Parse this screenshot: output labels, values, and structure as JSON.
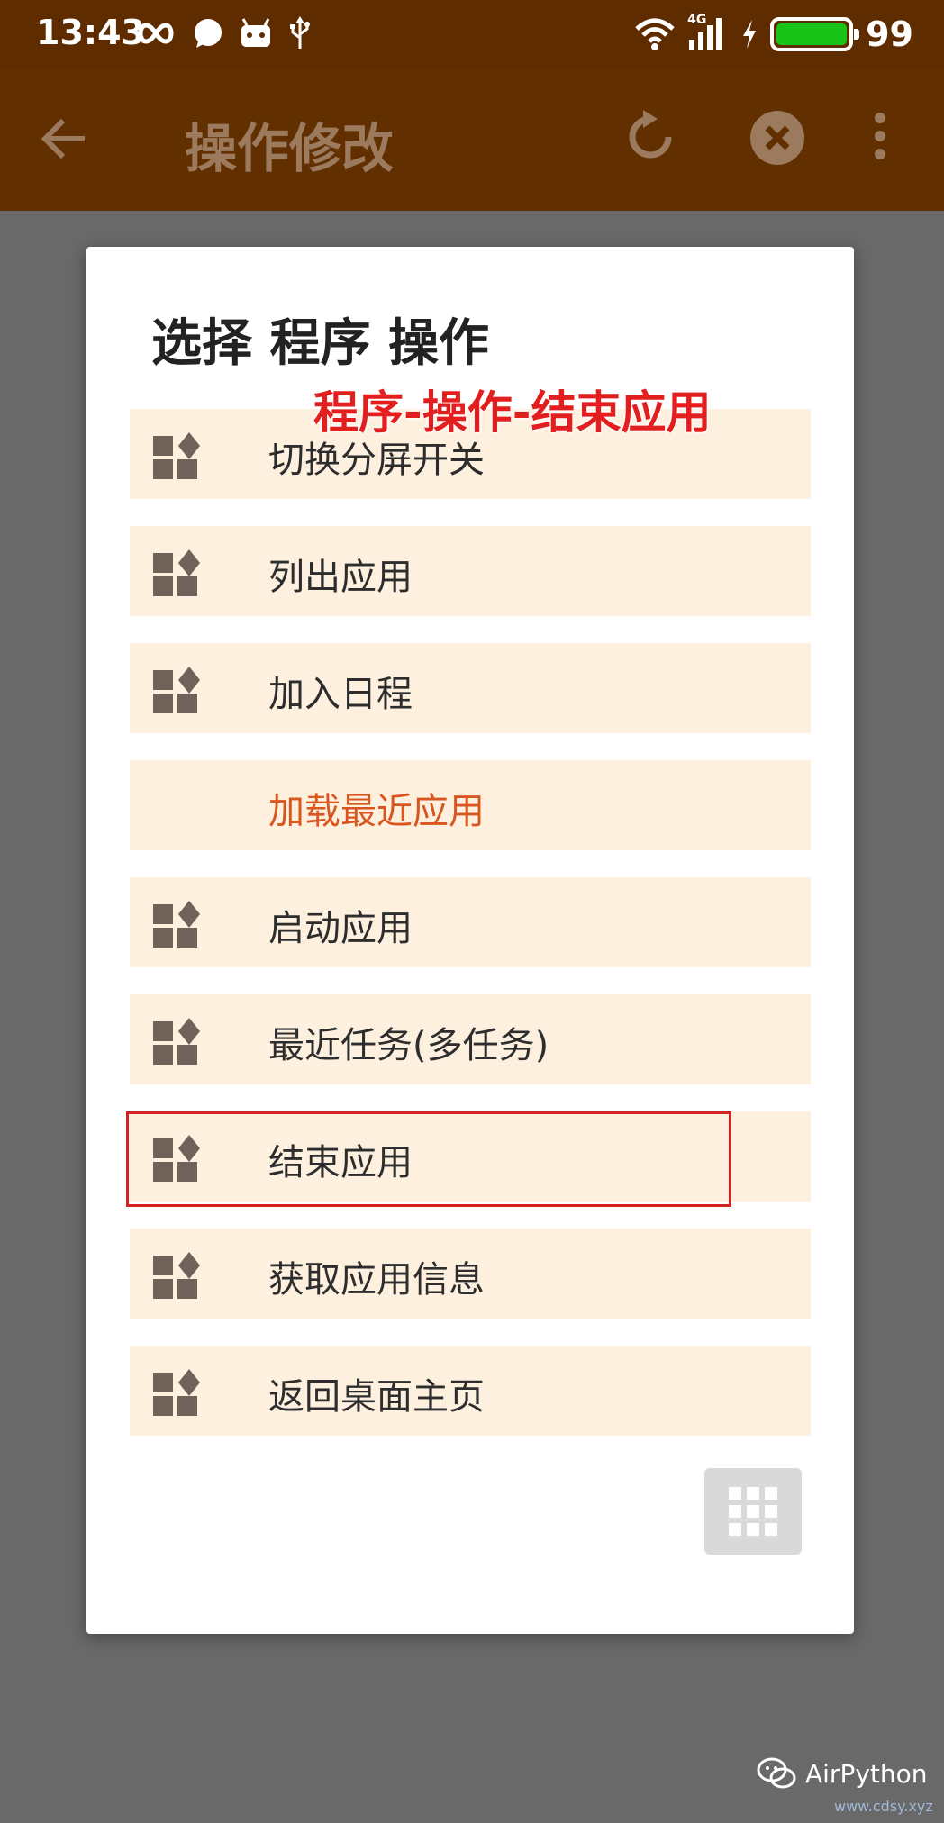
{
  "status_bar": {
    "time": "13:43",
    "network": "4G",
    "battery_level": "99",
    "colors": {
      "background": "#5f2c00",
      "battery": "#18c418"
    }
  },
  "app_bar": {
    "title": "操作修改",
    "icons": [
      "arrow-back-icon",
      "refresh-icon",
      "close-circle-icon",
      "more-vert-icon"
    ]
  },
  "dialog": {
    "title": "选择 程序 操作",
    "annotation": "程序-操作-结束应用",
    "items": [
      {
        "label": "切换分屏开关",
        "icon": "apps-icon"
      },
      {
        "label": "列出应用",
        "icon": "apps-icon"
      },
      {
        "label": "加入日程",
        "icon": "apps-icon"
      },
      {
        "label": "加载最近应用",
        "icon": "",
        "highlighted": true
      },
      {
        "label": "启动应用",
        "icon": "apps-icon"
      },
      {
        "label": "最近任务(多任务)",
        "icon": "apps-icon"
      },
      {
        "label": "结束应用",
        "icon": "apps-icon",
        "selected": true
      },
      {
        "label": "获取应用信息",
        "icon": "apps-icon"
      },
      {
        "label": "返回桌面主页",
        "icon": "apps-icon"
      }
    ],
    "grid_button_icon": "grid-icon",
    "colors": {
      "item_background": "#fdf0df",
      "highlight_text": "#d9561f",
      "annotation": "#e31e1e"
    }
  },
  "watermark": {
    "brand": "AirPython",
    "sub": "www.cdsy.xyz"
  }
}
